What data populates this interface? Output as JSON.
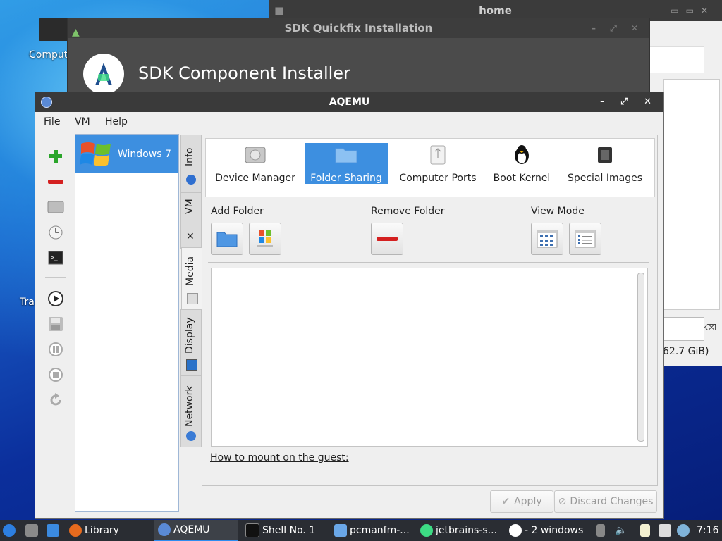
{
  "desktop": {
    "icons": [
      {
        "label": "Comput"
      },
      {
        "label": "Tra"
      }
    ]
  },
  "home_window": {
    "title": "home",
    "free_space": "62.7 GiB)"
  },
  "sdk_window": {
    "title": "SDK Quickfix Installation",
    "heading": "SDK Component Installer"
  },
  "aqemu": {
    "title": "AQEMU",
    "menu": [
      "File",
      "VM",
      "Help"
    ],
    "vm_list": [
      {
        "name": "Windows 7"
      }
    ],
    "side_tabs": [
      "Info",
      "VM",
      "Media",
      "Display",
      "Network"
    ],
    "top_buttons": [
      "Device Manager",
      "Folder Sharing",
      "Computer Ports",
      "Boot Kernel",
      "Special Images"
    ],
    "selected_top_button": "Folder Sharing",
    "groups": {
      "add_folder": "Add Folder",
      "remove_folder": "Remove Folder",
      "view_mode": "View Mode"
    },
    "howto_link": "How to mount on the guest:",
    "buttons": {
      "apply": "Apply",
      "discard": "Discard Changes"
    }
  },
  "taskbar": {
    "items": [
      "Library",
      "AQEMU",
      "Shell No. 1",
      "pcmanfm-...",
      "jetbrains-s...",
      "- 2 windows"
    ],
    "clock": "7:16"
  },
  "colors": {
    "accent": "#3d8fe0",
    "titlebar": "#3a3a3a",
    "taskbar": "#2a2d33"
  }
}
